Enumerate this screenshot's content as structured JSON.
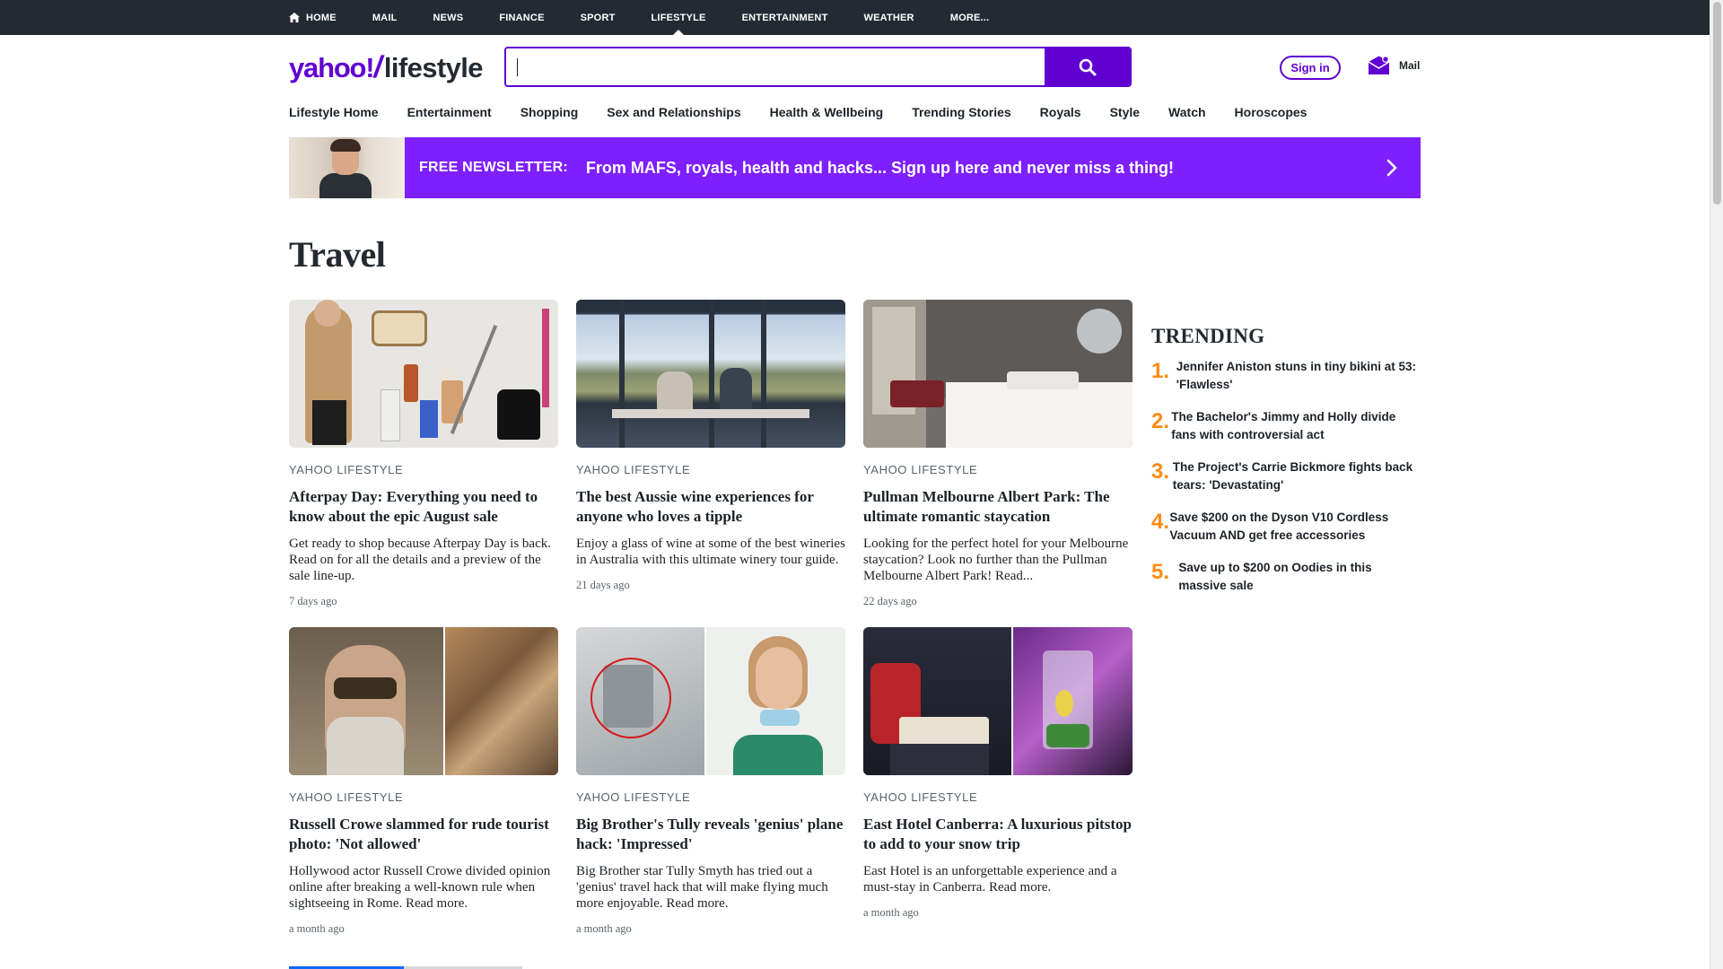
{
  "topnav": {
    "items": [
      {
        "label": "HOME",
        "icon": "home-icon"
      },
      {
        "label": "MAIL"
      },
      {
        "label": "NEWS"
      },
      {
        "label": "FINANCE"
      },
      {
        "label": "SPORT"
      },
      {
        "label": "LIFESTYLE",
        "active": true
      },
      {
        "label": "ENTERTAINMENT"
      },
      {
        "label": "WEATHER"
      },
      {
        "label": "MORE..."
      }
    ]
  },
  "header": {
    "logo_left": "yahoo!",
    "logo_right": "lifestyle",
    "search_value": "",
    "search_icon": "search-icon",
    "signin_label": "Sign in",
    "mail_label": "Mail",
    "brand_color": "#6001d2"
  },
  "subnav": {
    "items": [
      "Lifestyle Home",
      "Entertainment",
      "Shopping",
      "Sex and Relationships",
      "Health & Wellbeing",
      "Trending Stories",
      "Royals",
      "Style",
      "Watch",
      "Horoscopes"
    ]
  },
  "banner": {
    "label": "FREE NEWSLETTER:",
    "text": "From MAFS, royals, health and hacks... Sign up here and never miss a thing!",
    "color": "#7e1fff"
  },
  "page": {
    "title": "Travel"
  },
  "cards": [
    {
      "source": "YAHOO LIFESTYLE",
      "headline": "Afterpay Day: Everything you need to know about the epic August sale",
      "description": "Get ready to shop because Afterpay Day is back. Read on for all the details and a preview of the sale line-up.",
      "time": "7 days ago"
    },
    {
      "source": "YAHOO LIFESTYLE",
      "headline": "The best Aussie wine experiences for anyone who loves a tipple",
      "description": "Enjoy a glass of wine at some of the best wineries in Australia with this ultimate winery tour guide.",
      "time": "21 days ago"
    },
    {
      "source": "YAHOO LIFESTYLE",
      "headline": "Pullman Melbourne Albert Park: The ultimate romantic staycation",
      "description": "Looking for the perfect hotel for your Melbourne staycation? Look no further than the Pullman Melbourne Albert Park! Read...",
      "time": "22 days ago"
    },
    {
      "source": "YAHOO LIFESTYLE",
      "headline": "Russell Crowe slammed for rude tourist photo: 'Not allowed'",
      "description": "Hollywood actor Russell Crowe divided opinion online after breaking a well-known rule when sightseeing in Rome. Read more.",
      "time": "a month ago"
    },
    {
      "source": "YAHOO LIFESTYLE",
      "headline": "Big Brother's Tully reveals 'genius' plane hack: 'Impressed'",
      "description": "Big Brother star Tully Smyth has tried out a 'genius' travel hack that will make flying much more enjoyable. Read more.",
      "time": "a month ago"
    },
    {
      "source": "YAHOO LIFESTYLE",
      "headline": "East Hotel Canberra: A luxurious pitstop to add to your snow trip",
      "description": "East Hotel is an unforgettable experience and a must-stay in Canberra. Read more.",
      "time": "a month ago"
    }
  ],
  "trending": {
    "title": "TRENDING",
    "number_color": "#ff8b12",
    "items": [
      {
        "num": "1.",
        "text": "Jennifer Aniston stuns in tiny bikini at 53: 'Flawless'"
      },
      {
        "num": "2.",
        "text": "The Bachelor's Jimmy and Holly divide fans with controversial act"
      },
      {
        "num": "3.",
        "text": "The Project's Carrie Bickmore fights back tears: 'Devastating'"
      },
      {
        "num": "4.",
        "text": "Save $200 on the Dyson V10 Cordless Vacuum AND get free accessories"
      },
      {
        "num": "5.",
        "text": "Save up to $200 on Oodies in this massive sale"
      }
    ]
  }
}
